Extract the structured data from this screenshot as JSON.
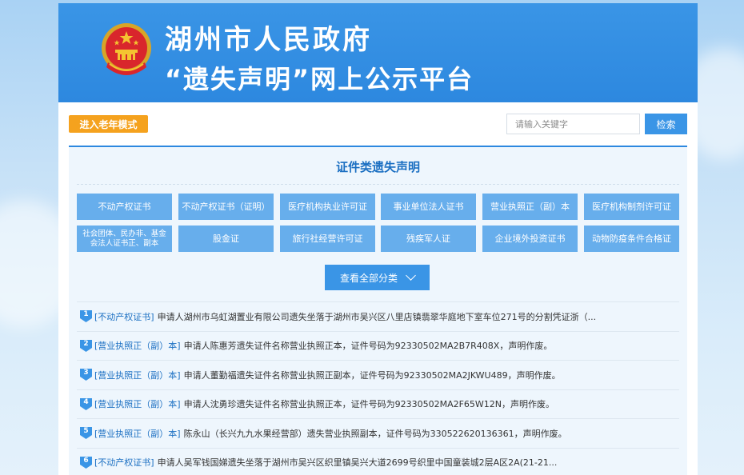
{
  "banner": {
    "title": "湖州市人民政府",
    "subtitle": "“遗失声明”网上公示平台"
  },
  "toolbar": {
    "elder_mode_label": "进入老年模式",
    "search_placeholder": "请输入关键字",
    "search_button_label": "检索"
  },
  "panel": {
    "title": "证件类遗失声明",
    "categories": [
      "不动产权证书",
      "不动产权证书（证明）",
      "医疗机构执业许可证",
      "事业单位法人证书",
      "营业执照正（副）本",
      "医疗机构制剂许可证",
      "社会团体、民办非、基金会法人证书正、副本",
      "股金证",
      "旅行社经营许可证",
      "残疾军人证",
      "企业境外投资证书",
      "动物防疫条件合格证"
    ],
    "view_all_label": "查看全部分类"
  },
  "notices": [
    {
      "num": "1",
      "tag": "[不动产权证书]",
      "text": "申请人湖州市乌虹湖置业有限公司遗失坐落于湖州市吴兴区八里店镇翡翠华庭地下室车位271号的分割凭证浙（..."
    },
    {
      "num": "2",
      "tag": "[营业执照正（副）本]",
      "text": "申请人陈惠芳遗失证件名称营业执照正本，证件号码为92330502MA2B7R408X，声明作废。"
    },
    {
      "num": "3",
      "tag": "[营业执照正（副）本]",
      "text": "申请人董勤福遗失证件名称营业执照正副本，证件号码为92330502MA2JKWU489，声明作废。"
    },
    {
      "num": "4",
      "tag": "[营业执照正（副）本]",
      "text": "申请人沈勇珍遗失证件名称营业执照正本，证件号码为92330502MA2F65W12N，声明作废。"
    },
    {
      "num": "5",
      "tag": "[营业执照正（副）本]",
      "text": "陈永山（长兴九九水果经营部）遗失营业执照副本，证件号码为330522620136361，声明作废。"
    },
    {
      "num": "6",
      "tag": "[不动产权证书]",
      "text": "申请人吴军钱国娣遗失坐落于湖州市吴兴区织里镇吴兴大道2699号织里中国童装城2层A区2A(21-21..."
    }
  ],
  "colors": {
    "banner_blue": "#2d88df",
    "category_blue": "#67aeec",
    "elder_orange": "#f5a21e",
    "tag_blue": "#1b6fc2"
  },
  "icons": {
    "emblem": "national-emblem-icon",
    "view_all": "chevron-down-icon",
    "list_marker": "numbered-pin-icon"
  }
}
